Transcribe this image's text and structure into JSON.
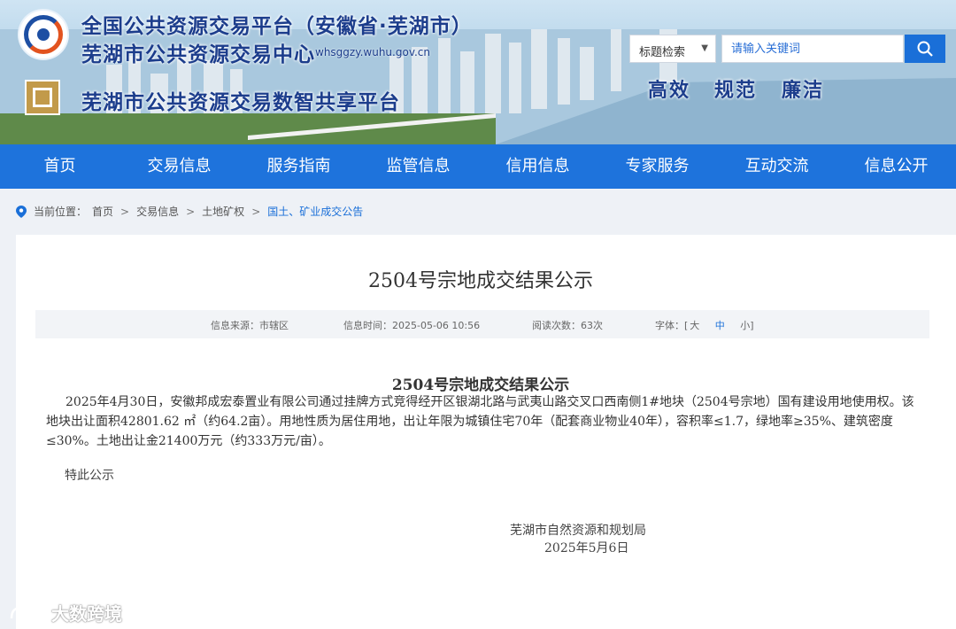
{
  "header": {
    "title_line1": "全国公共资源交易平台（安徽省·芜湖市）",
    "title_line2": "芜湖市公共资源交易中心",
    "domain": "whsggzy.wuhu.gov.cn",
    "title_line3": "芜湖市公共资源交易数智共享平台",
    "search": {
      "select_value": "标题检索",
      "placeholder": "请输入关键词"
    },
    "slogans": [
      "高效",
      "规范",
      "廉洁"
    ]
  },
  "nav": {
    "items": [
      "首页",
      "交易信息",
      "服务指南",
      "监管信息",
      "信用信息",
      "专家服务",
      "互动交流",
      "信息公开"
    ]
  },
  "breadcrumb": {
    "label": "当前位置：",
    "items": [
      "首页",
      "交易信息",
      "土地矿权",
      "国土、矿业成交公告"
    ]
  },
  "article": {
    "title": "2504号宗地成交结果公示",
    "meta": {
      "source": "信息来源：市辖区",
      "time": "信息时间：2025-05-06 10:56",
      "views": "阅读次数：63次",
      "font_label": "字体：[",
      "font_large": "大",
      "font_medium": "中",
      "font_small": "小]"
    },
    "doc_title": "2504号宗地成交结果公示",
    "body": "2025年4月30日，安徽邦成宏泰置业有限公司通过挂牌方式竞得经开区银湖北路与武夷山路交叉口西南侧1#地块（2504号宗地）国有建设用地使用权。该地块出让面积42801.62 ㎡（约64.2亩）。用地性质为居住用地，出让年限为城镇住宅70年（配套商业物业40年），容积率≤1.7，绿地率≥35%、建筑密度≤30%。土地出让金21400万元（约333万元/亩）。",
    "notice": "特此公示",
    "sign_org": "芜湖市自然资源和规划局",
    "sign_date": "2025年5月6日"
  },
  "watermark": "大数跨境"
}
